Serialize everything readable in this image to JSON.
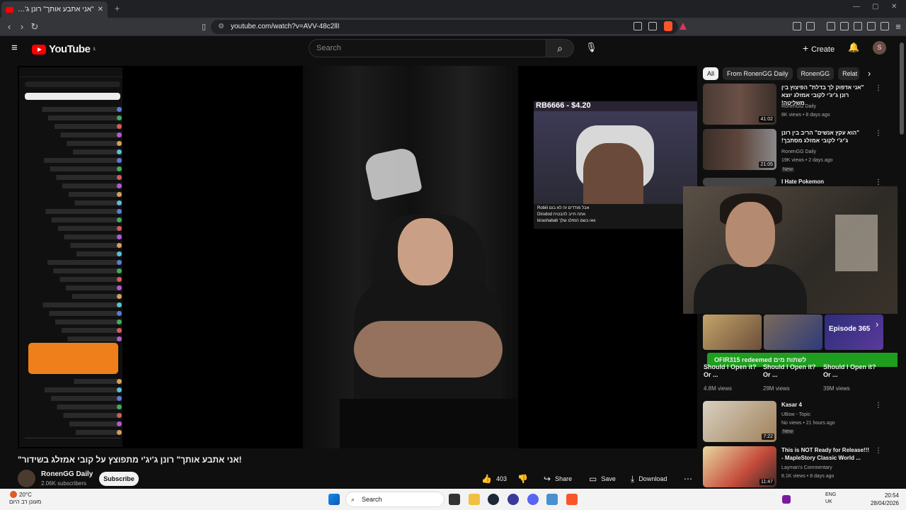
{
  "browser": {
    "tab_title": "\"אני אתבע אותך\" רונן ג'יג'י מתפוצץ",
    "url": "youtube.com/watch?v=AVV-48c2llI"
  },
  "youtube": {
    "logo_text": "YouTube",
    "logo_country": "IL",
    "search_placeholder": "Search",
    "create_label": "Create",
    "avatar_letter": "S"
  },
  "video_overlay": {
    "donation_text": "RB6666 - $4.20",
    "redeem_text": "OFIR315 redeemed לשתות מים",
    "chat_lines": [
      "Robiii אבל מודדים זה לא בום",
      "Dirodod אתה חייב להבטיח",
      "kirashabab וואו בשם המזלג שלך"
    ]
  },
  "video": {
    "title": "\"אני אתבע אותך\" רונן ג'יג'י מתפוצץ על קובי אמזלג בשידור!",
    "channel": "RonenGG Daily",
    "subscribers": "2.06K subscribers",
    "subscribe_label": "Subscribe",
    "likes": "403",
    "share_label": "Share",
    "save_label": "Save",
    "download_label": "Download"
  },
  "sidebar": {
    "chips": [
      "All",
      "From RonenGG Daily",
      "RonenGG",
      "Relat"
    ],
    "recs": [
      {
        "title": "\"אני אדפוק לך בדלת\" הפיצוץ בין רונן ג'יג'י לקובי אמזלג יוצא משליטה!",
        "channel": "RonenGG Daily",
        "meta": "8K views • 8 days ago",
        "duration": "41:02"
      },
      {
        "title": "\"הוא עקץ אנשים\" הריב בין רונן ג'יג'י לקובי אמזלג מסתבך!",
        "channel": "RonenGG Daily",
        "meta": "19K views • 2 days ago",
        "duration": "21:05",
        "badge": "New"
      },
      {
        "title": "I Hate Pokemon",
        "channel": "",
        "meta": "",
        "duration": ""
      },
      {
        "title": "Kasar 4",
        "channel": "UBow - Topic",
        "meta": "No views • 21 hours ago",
        "duration": "7:22",
        "badge": "New"
      },
      {
        "title": "This is NOT Ready for Release!!! - MapleStory Classic World ...",
        "channel": "Layman's Commentary",
        "meta": "8.1K views • 8 days ago",
        "duration": "11:47"
      }
    ],
    "shorts": [
      {
        "title": "Should I Open it? Or ...",
        "views": "4.8M views"
      },
      {
        "title": "Should I Open it? Or ...",
        "views": "29M views"
      },
      {
        "title": "Should I Open it? Or ...",
        "views": "39M views"
      }
    ],
    "shorts_badge": "Episode 365"
  },
  "taskbar": {
    "weather_temp": "20°C",
    "weather_desc": "מעונן רב היום",
    "search_label": "Search",
    "lang_line1": "ENG",
    "lang_line2": "UK",
    "time": "20:54",
    "date": "28/04/2026"
  }
}
